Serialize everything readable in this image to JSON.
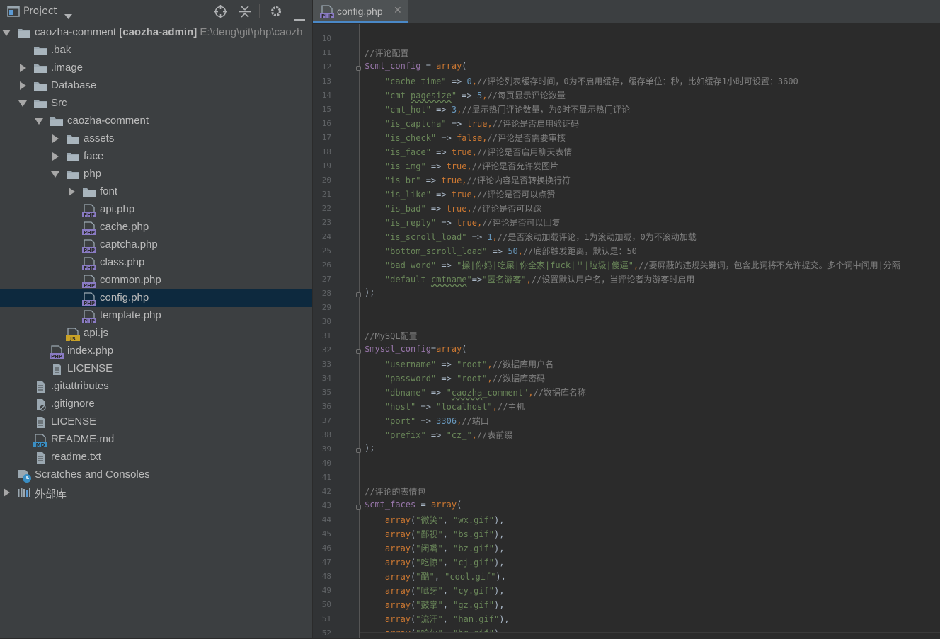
{
  "project_panel": {
    "title": "Project",
    "toolbar": [
      "locate-icon",
      "collapse-all-icon",
      "gear-icon",
      "hide-icon"
    ]
  },
  "tree": [
    {
      "label": "caozha-comment",
      "module": "[caozha-admin]",
      "path": "E:\\deng\\git\\php\\caozh",
      "type": "folder",
      "depth": 0,
      "expanded": true
    },
    {
      "label": ".bak",
      "type": "folder",
      "depth": 1
    },
    {
      "label": ".image",
      "type": "folder",
      "depth": 1,
      "expanded": false
    },
    {
      "label": "Database",
      "type": "folder",
      "depth": 1,
      "expanded": false
    },
    {
      "label": "Src",
      "type": "folder",
      "depth": 1,
      "expanded": true
    },
    {
      "label": "caozha-comment",
      "type": "folder",
      "depth": 2,
      "expanded": true
    },
    {
      "label": "assets",
      "type": "folder",
      "depth": 3,
      "expanded": false
    },
    {
      "label": "face",
      "type": "folder",
      "depth": 3,
      "expanded": false
    },
    {
      "label": "php",
      "type": "folder",
      "depth": 3,
      "expanded": true
    },
    {
      "label": "font",
      "type": "folder",
      "depth": 4,
      "expanded": false
    },
    {
      "label": "api.php",
      "type": "php",
      "depth": 4
    },
    {
      "label": "cache.php",
      "type": "php",
      "depth": 4
    },
    {
      "label": "captcha.php",
      "type": "php",
      "depth": 4
    },
    {
      "label": "class.php",
      "type": "php",
      "depth": 4
    },
    {
      "label": "common.php",
      "type": "php",
      "depth": 4
    },
    {
      "label": "config.php",
      "type": "php",
      "depth": 4,
      "selected": true
    },
    {
      "label": "template.php",
      "type": "php",
      "depth": 4
    },
    {
      "label": "api.js",
      "type": "js",
      "depth": 3
    },
    {
      "label": "index.php",
      "type": "php",
      "depth": 2
    },
    {
      "label": "LICENSE",
      "type": "text",
      "depth": 2
    },
    {
      "label": ".gitattributes",
      "type": "text",
      "depth": 1
    },
    {
      "label": ".gitignore",
      "type": "ignore",
      "depth": 1
    },
    {
      "label": "LICENSE",
      "type": "text",
      "depth": 1
    },
    {
      "label": "README.md",
      "type": "md",
      "depth": 1
    },
    {
      "label": "readme.txt",
      "type": "text",
      "depth": 1
    },
    {
      "label": "Scratches and Consoles",
      "type": "scratch",
      "depth": 0
    },
    {
      "label": "外部库",
      "type": "library",
      "depth": 0,
      "expanded": false
    }
  ],
  "editor": {
    "tab": {
      "label": "config.php",
      "close": "✕",
      "badge": "PHP"
    },
    "icon_badges": {
      "php": "PHP",
      "js": "JS",
      "md": "MD"
    },
    "lines": [
      {
        "no": "10",
        "tokens": []
      },
      {
        "no": "11",
        "tokens": [
          [
            "c",
            "//评论配置"
          ]
        ]
      },
      {
        "no": "12",
        "fold": true,
        "tokens": [
          [
            "v",
            "$cmt_config"
          ],
          [
            "",
            " = "
          ],
          [
            "k",
            "array"
          ],
          [
            "",
            "("
          ]
        ]
      },
      {
        "no": "13",
        "tokens": [
          [
            "",
            "    "
          ],
          [
            "s",
            "\"cache_time\""
          ],
          [
            "",
            " => "
          ],
          [
            "n",
            "0"
          ],
          [
            "k",
            ","
          ],
          [
            "c",
            "//评论列表缓存时间，0为不启用缓存，缓存单位：秒，比如缓存1小时可设置：3600"
          ]
        ]
      },
      {
        "no": "14",
        "tokens": [
          [
            "",
            "    "
          ],
          [
            "s",
            "\"cmt_"
          ],
          [
            "su",
            "pagesize"
          ],
          [
            "s",
            "\""
          ],
          [
            "",
            " => "
          ],
          [
            "n",
            "5"
          ],
          [
            "k",
            ","
          ],
          [
            "c",
            "//每页显示评论数量"
          ]
        ]
      },
      {
        "no": "15",
        "tokens": [
          [
            "",
            "    "
          ],
          [
            "s",
            "\"cmt_hot\""
          ],
          [
            "",
            " => "
          ],
          [
            "n",
            "3"
          ],
          [
            "k",
            ","
          ],
          [
            "c",
            "//显示热门评论数量，为0时不显示热门评论"
          ]
        ]
      },
      {
        "no": "16",
        "tokens": [
          [
            "",
            "    "
          ],
          [
            "s",
            "\"is_captcha\""
          ],
          [
            "",
            " => "
          ],
          [
            "k",
            "true,"
          ],
          [
            "c",
            "//评论是否启用验证码"
          ]
        ]
      },
      {
        "no": "17",
        "tokens": [
          [
            "",
            "    "
          ],
          [
            "s",
            "\"is_check\""
          ],
          [
            "",
            " => "
          ],
          [
            "k",
            "false,"
          ],
          [
            "c",
            "//评论是否需要审核"
          ]
        ]
      },
      {
        "no": "18",
        "tokens": [
          [
            "",
            "    "
          ],
          [
            "s",
            "\"is_face\""
          ],
          [
            "",
            " => "
          ],
          [
            "k",
            "true,"
          ],
          [
            "c",
            "//评论是否启用聊天表情"
          ]
        ]
      },
      {
        "no": "19",
        "tokens": [
          [
            "",
            "    "
          ],
          [
            "s",
            "\"is_img\""
          ],
          [
            "",
            " => "
          ],
          [
            "k",
            "true,"
          ],
          [
            "c",
            "//评论是否允许发图片"
          ]
        ]
      },
      {
        "no": "20",
        "tokens": [
          [
            "",
            "    "
          ],
          [
            "s",
            "\"is_br\""
          ],
          [
            "",
            " => "
          ],
          [
            "k",
            "true,"
          ],
          [
            "c",
            "//评论内容是否转换换行符"
          ]
        ]
      },
      {
        "no": "21",
        "tokens": [
          [
            "",
            "    "
          ],
          [
            "s",
            "\"is_like\""
          ],
          [
            "",
            " => "
          ],
          [
            "k",
            "true,"
          ],
          [
            "c",
            "//评论是否可以点赞"
          ]
        ]
      },
      {
        "no": "22",
        "tokens": [
          [
            "",
            "    "
          ],
          [
            "s",
            "\"is_bad\""
          ],
          [
            "",
            " => "
          ],
          [
            "k",
            "true,"
          ],
          [
            "c",
            "//评论是否可以踩"
          ]
        ]
      },
      {
        "no": "23",
        "tokens": [
          [
            "",
            "    "
          ],
          [
            "s",
            "\"is_reply\""
          ],
          [
            "",
            " => "
          ],
          [
            "k",
            "true,"
          ],
          [
            "c",
            "//评论是否可以回复"
          ]
        ]
      },
      {
        "no": "24",
        "tokens": [
          [
            "",
            "    "
          ],
          [
            "s",
            "\"is_scroll_load\""
          ],
          [
            "",
            " => "
          ],
          [
            "n",
            "1"
          ],
          [
            "k",
            ","
          ],
          [
            "c",
            "//是否滚动加载评论，1为滚动加载，0为不滚动加载"
          ]
        ]
      },
      {
        "no": "25",
        "tokens": [
          [
            "",
            "    "
          ],
          [
            "s",
            "\"bottom_scroll_load\""
          ],
          [
            "",
            " => "
          ],
          [
            "n",
            "50"
          ],
          [
            "k",
            ","
          ],
          [
            "c",
            "//底部触发距离，默认是：50"
          ]
        ]
      },
      {
        "no": "26",
        "tokens": [
          [
            "",
            "    "
          ],
          [
            "s",
            "\"bad_word\""
          ],
          [
            "",
            " => "
          ],
          [
            "s",
            "\"操|你妈|吃屎|你全家|fuck|艹|垃圾|傻逼\""
          ],
          [
            "k",
            ","
          ],
          [
            "c",
            "//要屏蔽的违规关键词，包含此词将不允许提交。多个词中间用|分隔"
          ]
        ]
      },
      {
        "no": "27",
        "tokens": [
          [
            "",
            "    "
          ],
          [
            "s",
            "\"default_"
          ],
          [
            "su",
            "cmtname"
          ],
          [
            "s",
            "\""
          ],
          [
            "",
            "=>"
          ],
          [
            "s",
            "\"匿名游客\""
          ],
          [
            "k",
            ","
          ],
          [
            "c",
            "//设置默认用户名，当评论者为游客时启用"
          ]
        ]
      },
      {
        "no": "28",
        "fold": true,
        "tokens": [
          [
            "",
            ");"
          ]
        ]
      },
      {
        "no": "29",
        "tokens": []
      },
      {
        "no": "30",
        "tokens": []
      },
      {
        "no": "31",
        "tokens": [
          [
            "c",
            "//MySQL配置"
          ]
        ]
      },
      {
        "no": "32",
        "fold": true,
        "tokens": [
          [
            "v",
            "$mysql_config"
          ],
          [
            "",
            "="
          ],
          [
            "k",
            "array"
          ],
          [
            "",
            "("
          ]
        ]
      },
      {
        "no": "33",
        "tokens": [
          [
            "",
            "    "
          ],
          [
            "s",
            "\"username\""
          ],
          [
            "",
            " => "
          ],
          [
            "s",
            "\"root\""
          ],
          [
            "k",
            ","
          ],
          [
            "c",
            "//数据库用户名"
          ]
        ]
      },
      {
        "no": "34",
        "tokens": [
          [
            "",
            "    "
          ],
          [
            "s",
            "\"password\""
          ],
          [
            "",
            " => "
          ],
          [
            "s",
            "\"root\""
          ],
          [
            "k",
            ","
          ],
          [
            "c",
            "//数据库密码"
          ]
        ]
      },
      {
        "no": "35",
        "tokens": [
          [
            "",
            "    "
          ],
          [
            "s",
            "\"dbname\""
          ],
          [
            "",
            " => "
          ],
          [
            "s",
            "\""
          ],
          [
            "su",
            "caozha"
          ],
          [
            "s",
            "_comment\""
          ],
          [
            "k",
            ","
          ],
          [
            "c",
            "//数据库名称"
          ]
        ]
      },
      {
        "no": "36",
        "tokens": [
          [
            "",
            "    "
          ],
          [
            "s",
            "\"host\""
          ],
          [
            "",
            " => "
          ],
          [
            "s",
            "\"localhost\""
          ],
          [
            "k",
            ","
          ],
          [
            "c",
            "//主机"
          ]
        ]
      },
      {
        "no": "37",
        "tokens": [
          [
            "",
            "    "
          ],
          [
            "s",
            "\"port\""
          ],
          [
            "",
            " => "
          ],
          [
            "n",
            "3306"
          ],
          [
            "k",
            ","
          ],
          [
            "c",
            "//端口"
          ]
        ]
      },
      {
        "no": "38",
        "tokens": [
          [
            "",
            "    "
          ],
          [
            "s",
            "\"prefix\""
          ],
          [
            "",
            " => "
          ],
          [
            "s",
            "\"cz_\""
          ],
          [
            "k",
            ","
          ],
          [
            "c",
            "//表前缀"
          ]
        ]
      },
      {
        "no": "39",
        "fold": true,
        "tokens": [
          [
            "",
            ");"
          ]
        ]
      },
      {
        "no": "40",
        "tokens": []
      },
      {
        "no": "41",
        "tokens": []
      },
      {
        "no": "42",
        "tokens": [
          [
            "c",
            "//评论的表情包"
          ]
        ]
      },
      {
        "no": "43",
        "fold": true,
        "tokens": [
          [
            "v",
            "$cmt_faces"
          ],
          [
            "",
            " = "
          ],
          [
            "k",
            "array"
          ],
          [
            "",
            "("
          ]
        ]
      },
      {
        "no": "44",
        "tokens": [
          [
            "",
            "    "
          ],
          [
            "k",
            "array"
          ],
          [
            "",
            "("
          ],
          [
            "s",
            "\"微笑\""
          ],
          [
            "",
            ", "
          ],
          [
            "s",
            "\"wx.gif\""
          ],
          [
            "",
            "),"
          ]
        ]
      },
      {
        "no": "45",
        "tokens": [
          [
            "",
            "    "
          ],
          [
            "k",
            "array"
          ],
          [
            "",
            "("
          ],
          [
            "s",
            "\"鄙视\""
          ],
          [
            "",
            ", "
          ],
          [
            "s",
            "\"bs.gif\""
          ],
          [
            "",
            "),"
          ]
        ]
      },
      {
        "no": "46",
        "tokens": [
          [
            "",
            "    "
          ],
          [
            "k",
            "array"
          ],
          [
            "",
            "("
          ],
          [
            "s",
            "\"闭嘴\""
          ],
          [
            "",
            ", "
          ],
          [
            "s",
            "\"bz.gif\""
          ],
          [
            "",
            "),"
          ]
        ]
      },
      {
        "no": "47",
        "tokens": [
          [
            "",
            "    "
          ],
          [
            "k",
            "array"
          ],
          [
            "",
            "("
          ],
          [
            "s",
            "\"吃惊\""
          ],
          [
            "",
            ", "
          ],
          [
            "s",
            "\"cj.gif\""
          ],
          [
            "",
            "),"
          ]
        ]
      },
      {
        "no": "48",
        "tokens": [
          [
            "",
            "    "
          ],
          [
            "k",
            "array"
          ],
          [
            "",
            "("
          ],
          [
            "s",
            "\"酷\""
          ],
          [
            "",
            ", "
          ],
          [
            "s",
            "\"cool.gif\""
          ],
          [
            "",
            "),"
          ]
        ]
      },
      {
        "no": "49",
        "tokens": [
          [
            "",
            "    "
          ],
          [
            "k",
            "array"
          ],
          [
            "",
            "("
          ],
          [
            "s",
            "\"呲牙\""
          ],
          [
            "",
            ", "
          ],
          [
            "s",
            "\"cy.gif\""
          ],
          [
            "",
            "),"
          ]
        ]
      },
      {
        "no": "50",
        "tokens": [
          [
            "",
            "    "
          ],
          [
            "k",
            "array"
          ],
          [
            "",
            "("
          ],
          [
            "s",
            "\"鼓掌\""
          ],
          [
            "",
            ", "
          ],
          [
            "s",
            "\"gz.gif\""
          ],
          [
            "",
            "),"
          ]
        ]
      },
      {
        "no": "51",
        "tokens": [
          [
            "",
            "    "
          ],
          [
            "k",
            "array"
          ],
          [
            "",
            "("
          ],
          [
            "s",
            "\"流汗\""
          ],
          [
            "",
            ", "
          ],
          [
            "s",
            "\"han.gif\""
          ],
          [
            "",
            "),"
          ]
        ]
      },
      {
        "no": "52",
        "tokens": [
          [
            "",
            "    "
          ],
          [
            "k",
            "array"
          ],
          [
            "",
            "("
          ],
          [
            "s",
            "\"哈欠\""
          ],
          [
            "",
            ", "
          ],
          [
            "s",
            "\"hq.gif\""
          ],
          [
            "",
            "),"
          ]
        ]
      }
    ]
  },
  "colors": {
    "panel_bg": "#3c3f41",
    "editor_bg": "#2b2b2b",
    "selection": "#0d293e",
    "folder": "#9aa7b0",
    "php_icon": "#8a7bc4",
    "js_icon": "#c9a227",
    "md_icon": "#3a8fc5",
    "keyword": "#cc7832",
    "string": "#6a8759",
    "number": "#6897bb",
    "comment": "#808080",
    "variable": "#9876aa"
  }
}
